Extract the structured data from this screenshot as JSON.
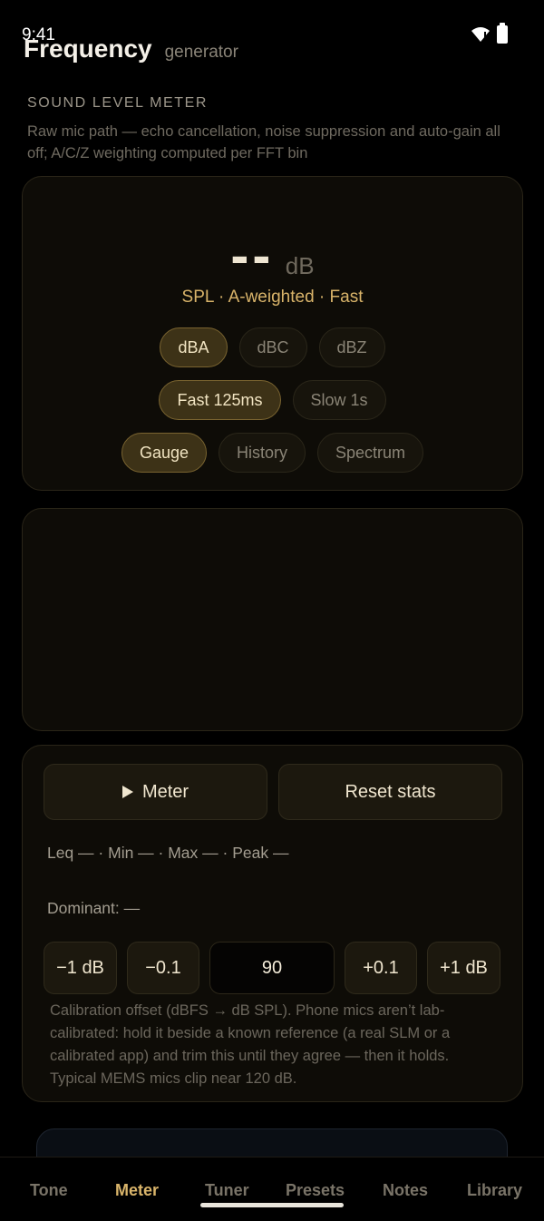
{
  "status": {
    "time": "9:41"
  },
  "header": {
    "title": "Frequency",
    "subtitle": "generator"
  },
  "section": {
    "label": "SOUND LEVEL METER",
    "description": "Raw mic path — echo cancellation, noise suppression and auto-gain all off; A/C/Z weighting computed per FFT bin"
  },
  "readout": {
    "value": "--",
    "unit": "dB",
    "caption": "SPL · A-weighted · Fast"
  },
  "weighting": {
    "options": [
      "dBA",
      "dBC",
      "dBZ"
    ],
    "selected": "dBA"
  },
  "response": {
    "options": [
      "Fast 125ms",
      "Slow 1s"
    ],
    "selected": "Fast 125ms"
  },
  "view": {
    "options": [
      "Gauge",
      "History",
      "Spectrum"
    ],
    "selected": "Gauge"
  },
  "controls": {
    "meter_label": "Meter",
    "reset_label": "Reset stats",
    "stats": "Leq — · Min — · Max — · Peak —",
    "dominant": "Dominant: —"
  },
  "calibration": {
    "minus_1": "−1 dB",
    "minus_01": "−0.1",
    "value": "90",
    "plus_01": "+0.1",
    "plus_1": "+1 dB",
    "help": "Calibration offset (dBFS → dB SPL). Phone mics aren’t lab-calibrated: hold it beside a known reference (a real SLM or a calibrated app) and trim this until they agree — then it holds. Typical MEMS mics clip near 120 dB."
  },
  "peek": {
    "text": ""
  },
  "nav": {
    "items": [
      "Tone",
      "Meter",
      "Tuner",
      "Presets",
      "Notes",
      "Library"
    ],
    "active": "Meter"
  },
  "colors": {
    "accent": "#d9b46a",
    "background": "#000000",
    "card": "#0e0c07"
  }
}
